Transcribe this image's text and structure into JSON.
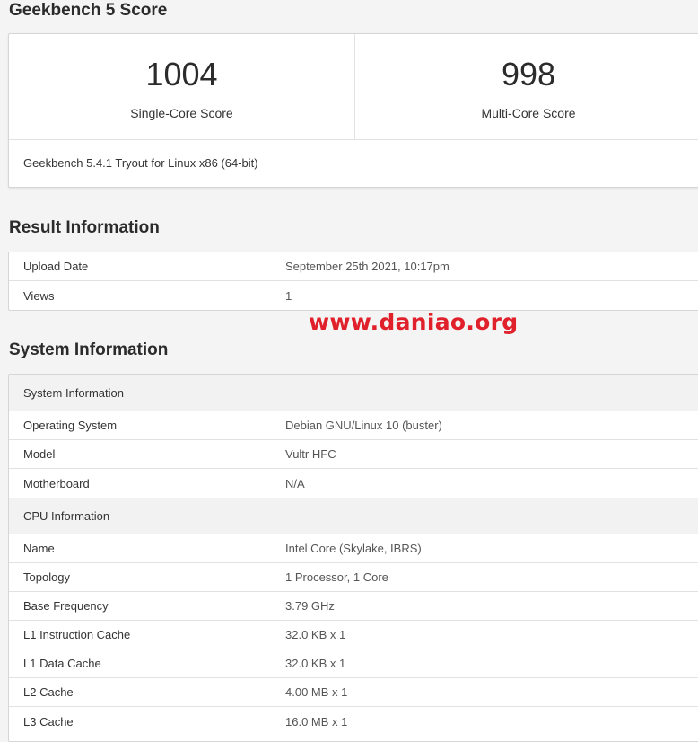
{
  "score_section": {
    "title": "Geekbench 5 Score",
    "single_core": {
      "value": "1004",
      "label": "Single-Core Score"
    },
    "multi_core": {
      "value": "998",
      "label": "Multi-Core Score"
    },
    "version": "Geekbench 5.4.1 Tryout for Linux x86 (64-bit)"
  },
  "result_section": {
    "title": "Result Information",
    "rows": [
      {
        "key": "Upload Date",
        "value": "September 25th 2021, 10:17pm"
      },
      {
        "key": "Views",
        "value": "1"
      }
    ]
  },
  "watermark": "www.daniao.org",
  "system_section": {
    "title": "System Information",
    "system_header": "System Information",
    "system_rows": [
      {
        "key": "Operating System",
        "value": "Debian GNU/Linux 10 (buster)"
      },
      {
        "key": "Model",
        "value": "Vultr HFC"
      },
      {
        "key": "Motherboard",
        "value": "N/A"
      }
    ],
    "cpu_header": "CPU Information",
    "cpu_rows": [
      {
        "key": "Name",
        "value": "Intel Core (Skylake, IBRS)"
      },
      {
        "key": "Topology",
        "value": "1 Processor, 1 Core"
      },
      {
        "key": "Base Frequency",
        "value": "3.79 GHz"
      },
      {
        "key": "L1 Instruction Cache",
        "value": "32.0 KB x 1"
      },
      {
        "key": "L1 Data Cache",
        "value": "32.0 KB x 1"
      },
      {
        "key": "L2 Cache",
        "value": "4.00 MB x 1"
      },
      {
        "key": "L3 Cache",
        "value": "16.0 MB x 1"
      }
    ]
  },
  "colors": {
    "watermark": "#e0202a",
    "page_background": "#f4f4f4",
    "group_header_background": "#f2f2f2"
  }
}
